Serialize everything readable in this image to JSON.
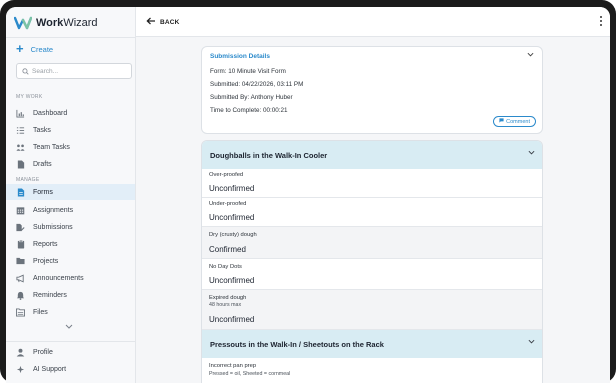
{
  "brand": {
    "name_bold": "Work",
    "name_rest": "Wizard"
  },
  "sidebar": {
    "create_label": "Create",
    "search_placeholder": "Search...",
    "section_my_work": "MY WORK",
    "section_manage": "MANAGE",
    "my_work_items": [
      {
        "label": "Dashboard",
        "icon": "bar-chart-icon"
      },
      {
        "label": "Tasks",
        "icon": "list-icon"
      },
      {
        "label": "Team Tasks",
        "icon": "team-icon"
      },
      {
        "label": "Drafts",
        "icon": "document-icon"
      }
    ],
    "manage_items": [
      {
        "label": "Forms",
        "icon": "form-icon",
        "active": true
      },
      {
        "label": "Assignments",
        "icon": "calendar-icon"
      },
      {
        "label": "Submissions",
        "icon": "submission-icon"
      },
      {
        "label": "Reports",
        "icon": "report-icon"
      },
      {
        "label": "Projects",
        "icon": "folder-icon"
      },
      {
        "label": "Announcements",
        "icon": "megaphone-icon"
      },
      {
        "label": "Reminders",
        "icon": "bell-icon"
      },
      {
        "label": "Files",
        "icon": "files-icon"
      }
    ],
    "bottom_items": [
      {
        "label": "Profile",
        "icon": "person-icon"
      },
      {
        "label": "AI Support",
        "icon": "sparkle-icon"
      }
    ]
  },
  "topbar": {
    "back_label": "BACK"
  },
  "submission": {
    "title": "Submission Details",
    "form": "Form: 10 Minute Visit Form",
    "submitted": "Submitted: 04/22/2026, 03:11 PM",
    "submitted_by": "Submitted By: Anthony Huber",
    "time_to_complete": "Time to Complete: 00:00:21",
    "comment_label": "Comment"
  },
  "sections": [
    {
      "title": "Doughballs in the Walk-In Cooler",
      "questions": [
        {
          "label": "Over-proofed",
          "answer": "Unconfirmed"
        },
        {
          "label": "Under-proofed",
          "answer": "Unconfirmed"
        },
        {
          "label": "Dry (crusty) dough",
          "answer": "Confirmed"
        },
        {
          "label": "No Day Dots",
          "answer": "Unconfirmed"
        },
        {
          "label": "Expired dough",
          "sub": "48 hours max",
          "answer": "Unconfirmed"
        }
      ]
    },
    {
      "title": "Pressouts in the Walk-In / Sheetouts on the Rack",
      "questions": [
        {
          "label": "Incorrect pan prep",
          "sub": "Pressed = oil, Sheeted = cornmeal"
        }
      ]
    }
  ],
  "colors": {
    "accent": "#2b8acb",
    "section_header": "#d8ecf3",
    "active_nav": "#e2eef8"
  }
}
